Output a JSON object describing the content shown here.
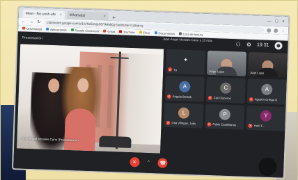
{
  "browser": {
    "tabs": [
      {
        "label": "Meet - fbc-uvsh-ufe",
        "active": true
      },
      {
        "label": "Whatsapp",
        "active": false
      }
    ],
    "url": "classroom.google.com/u/1/c/NzEzNjc0OTk4MjQy?authuser=1&tab=q",
    "bookmarks": [
      {
        "label": "Universidad",
        "color": "#ea4335"
      },
      {
        "label": "Aplicaciones",
        "color": "#4285f4"
      },
      {
        "label": "Google Classroom",
        "color": "#34a853"
      },
      {
        "label": "Gmail",
        "color": "#ea4335"
      },
      {
        "label": "YouTube",
        "color": "#ff0000"
      },
      {
        "label": "Drive",
        "color": "#fbbc05"
      },
      {
        "label": "Documentos",
        "color": "#4285f4"
      },
      {
        "label": "Lista de lectura",
        "color": "#5f6368"
      }
    ]
  },
  "meet": {
    "presenter_label": "Presentación",
    "meeting_title": "Juan Ángel Morales Cano y 10 más",
    "time": "19:31",
    "video_caption": "Juan Ángel Morales Cano (Presentación)",
    "tiles": [
      {
        "name": "Tú",
        "kind": "icon",
        "muted": true,
        "icon": "person"
      },
      {
        "name": "Jorge Lujan",
        "kind": "video",
        "muted": false
      },
      {
        "name": "Joan Lojas",
        "kind": "video-dark",
        "muted": false
      },
      {
        "name": "Angela Benlab",
        "kind": "avatar",
        "muted": true,
        "avatar_color": "#4a6fa5",
        "initial": "A"
      },
      {
        "name": "Celi Cisneros",
        "kind": "avatar",
        "muted": true,
        "avatar_color": "#6b6b6b",
        "initial": "C"
      },
      {
        "name": "Agustín Ortega G",
        "kind": "avatar",
        "muted": true,
        "avatar_color": "#7b7f86",
        "initial": "A"
      },
      {
        "name": "Lisa Villegas, Julio",
        "kind": "avatar",
        "muted": true,
        "avatar_color": "#b58a6b",
        "initial": "L"
      },
      {
        "name": "Pablo Castellanos",
        "kind": "avatar",
        "muted": true,
        "avatar_color": "#8a8d92",
        "initial": "P"
      },
      {
        "name": "Yorki F...",
        "kind": "avatar",
        "muted": true,
        "avatar_color": "#8b2a6b",
        "initial": "Y"
      }
    ],
    "controls": {
      "mic_label": "mic-off",
      "end_label": "end-call",
      "more_label": "^"
    }
  },
  "colors": {
    "meet_bg": "#202124",
    "alert_red": "#ea4335"
  }
}
